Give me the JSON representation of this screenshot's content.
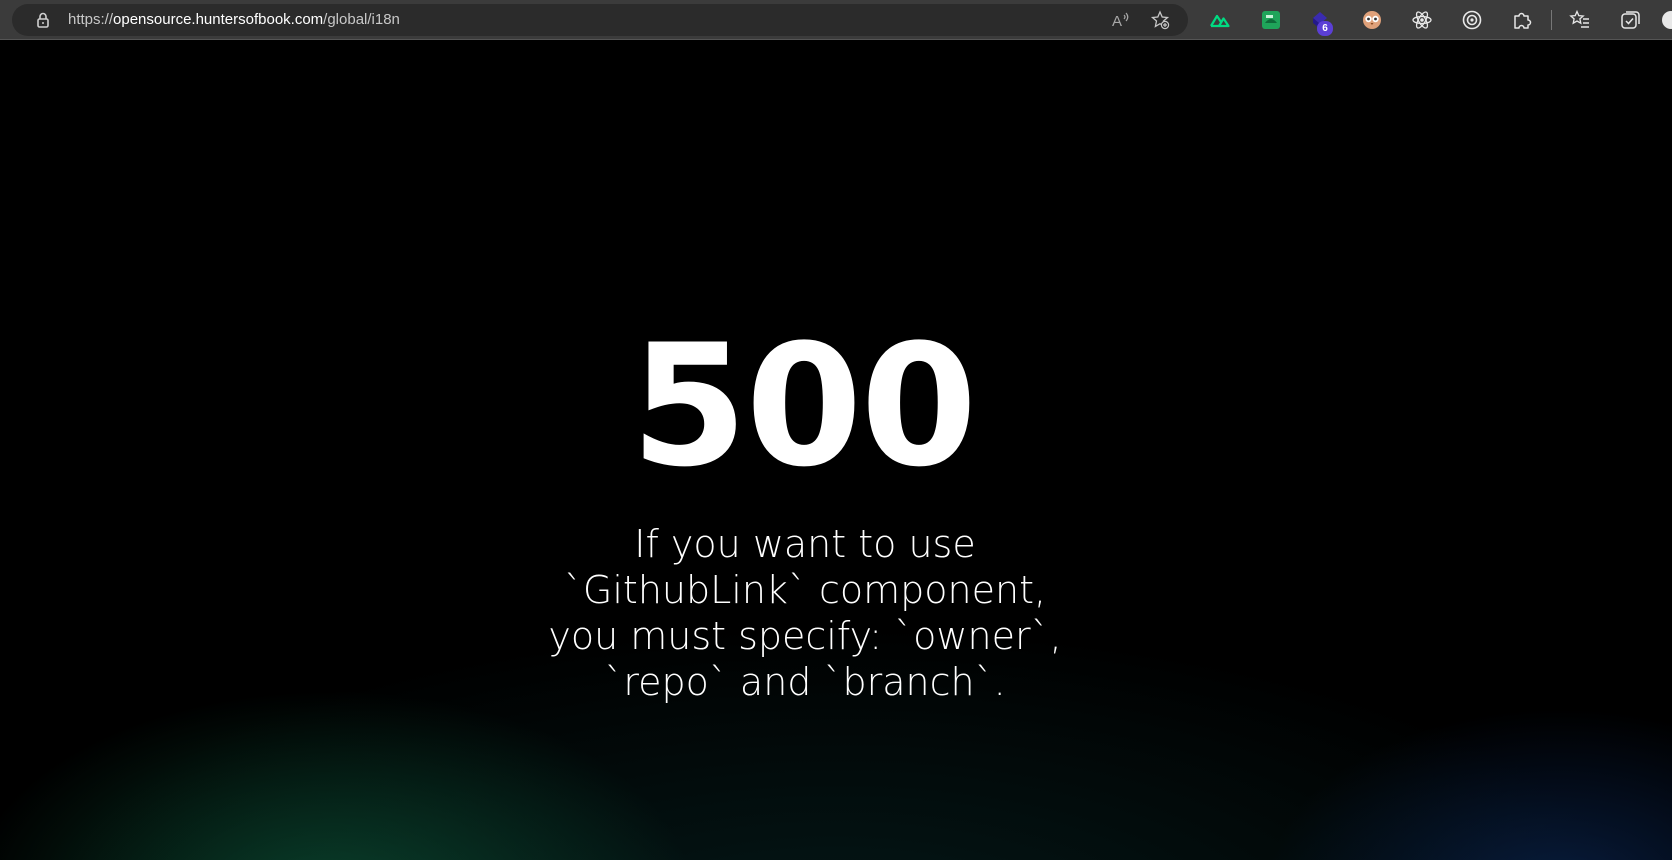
{
  "browser": {
    "url_scheme": "https://",
    "url_host": "opensource.huntersofbook.com",
    "url_path": "/global/i18n",
    "icons": {
      "lock": "lock-icon",
      "read_aloud": "read-aloud-icon",
      "add_favorite": "add-favorite-icon"
    },
    "extensions": [
      {
        "name": "nuxt-devtools-icon",
        "color": "#00dc82"
      },
      {
        "name": "green-extension-icon",
        "color": "#1fa45a"
      },
      {
        "name": "purple-extension-icon",
        "color": "#5b3fd6",
        "badge": "6"
      },
      {
        "name": "owl-extension-icon",
        "color": "#e0a17a"
      },
      {
        "name": "react-devtools-icon",
        "color": "#e8e8e8"
      },
      {
        "name": "target-extension-icon",
        "color": "#e8e8e8"
      },
      {
        "name": "extensions-puzzle-icon",
        "color": "#e8e8e8"
      },
      {
        "name": "favorites-icon",
        "color": "#e8e8e8"
      },
      {
        "name": "collections-icon",
        "color": "#e8e8e8"
      }
    ]
  },
  "error": {
    "code": "500",
    "message": "If you want to use `GithubLink` component, you must specify: `owner`, `repo` and `branch`."
  }
}
